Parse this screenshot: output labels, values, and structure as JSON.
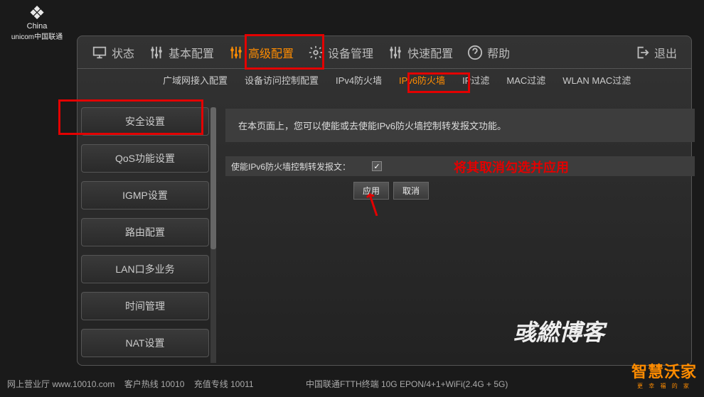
{
  "logo": {
    "line1": "China",
    "line2": "unicom中国联通"
  },
  "topnav": [
    {
      "label": "状态",
      "icon": "monitor"
    },
    {
      "label": "基本配置",
      "icon": "sliders"
    },
    {
      "label": "高级配置",
      "icon": "sliders",
      "active": true
    },
    {
      "label": "设备管理",
      "icon": "gear"
    },
    {
      "label": "快速配置",
      "icon": "sliders"
    },
    {
      "label": "帮助",
      "icon": "help"
    },
    {
      "label": "退出",
      "icon": "logout"
    }
  ],
  "subnav": [
    {
      "label": "广域网接入配置"
    },
    {
      "label": "设备访问控制配置"
    },
    {
      "label": "IPv4防火墙"
    },
    {
      "label": "IPv6防火墙",
      "active": true
    },
    {
      "label": "IP过滤"
    },
    {
      "label": "MAC过滤"
    },
    {
      "label": "WLAN MAC过滤"
    }
  ],
  "sidebar": [
    "安全设置",
    "QoS功能设置",
    "IGMP设置",
    "路由配置",
    "LAN口多业务",
    "时间管理",
    "NAT设置"
  ],
  "content": {
    "description": "在本页面上，您可以使能或去使能IPv6防火墙控制转发报文功能。",
    "checkbox_label": "使能IPv6防火墙控制转发报文：",
    "checkbox_checked": true,
    "apply": "应用",
    "cancel": "取消"
  },
  "annotation": {
    "text": "将其取消勾选并应用"
  },
  "watermark": "彧繎博客",
  "footer": {
    "hall": "网上营业厅 www.10010.com",
    "hotline": "客户热线 10010",
    "recharge": "充值专线 10011",
    "device": "中国联通FTTH终端 10G EPON/4+1+WiFi(2.4G + 5G)"
  },
  "bottom_logo": {
    "big": "智慧沃家",
    "small": "更 幸 福 的 家"
  }
}
